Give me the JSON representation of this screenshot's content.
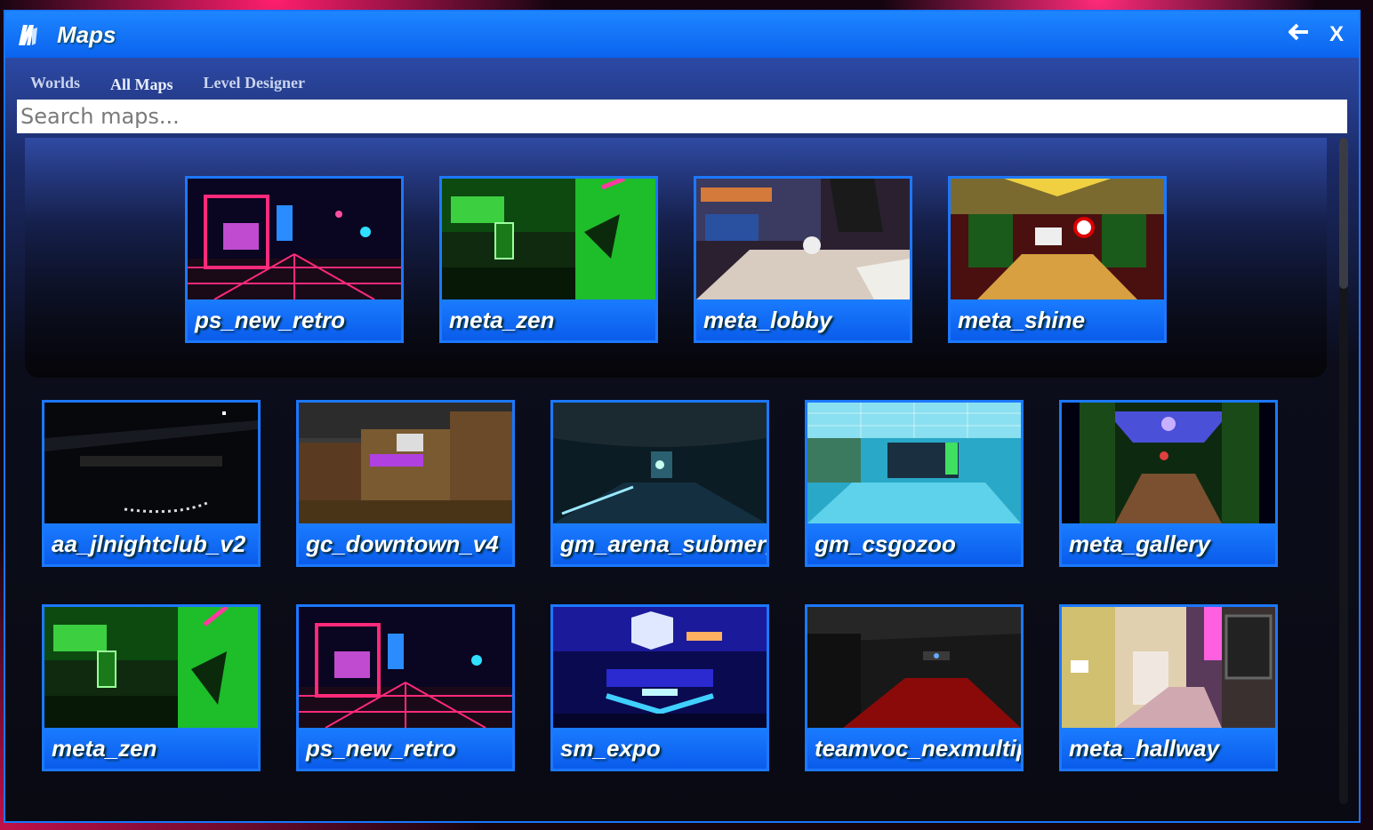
{
  "window": {
    "title": "Maps",
    "back_icon": "left-arrow-icon",
    "close_label": "X",
    "app_icon": "gmod-logo-icon"
  },
  "tabs": [
    {
      "label": "Worlds"
    },
    {
      "label": "All Maps"
    },
    {
      "label": "Level Designer"
    }
  ],
  "search": {
    "placeholder": "Search maps...",
    "value": ""
  },
  "featured": [
    {
      "name": "ps_new_retro"
    },
    {
      "name": "meta_zen"
    },
    {
      "name": "meta_lobby"
    },
    {
      "name": "meta_shine"
    }
  ],
  "maps": [
    {
      "name": "aa_jlnightclub_v2"
    },
    {
      "name": "gc_downtown_v4"
    },
    {
      "name": "gm_arena_submerged"
    },
    {
      "name": "gm_csgozoo"
    },
    {
      "name": "meta_gallery"
    },
    {
      "name": "meta_zen"
    },
    {
      "name": "ps_new_retro"
    },
    {
      "name": "sm_expo"
    },
    {
      "name": "teamvoc_nexmultiplayer"
    },
    {
      "name": "meta_hallway"
    }
  ],
  "colors": {
    "accent": "#1877ff",
    "titlebar": "#0a63ef",
    "background": "#07080d"
  }
}
